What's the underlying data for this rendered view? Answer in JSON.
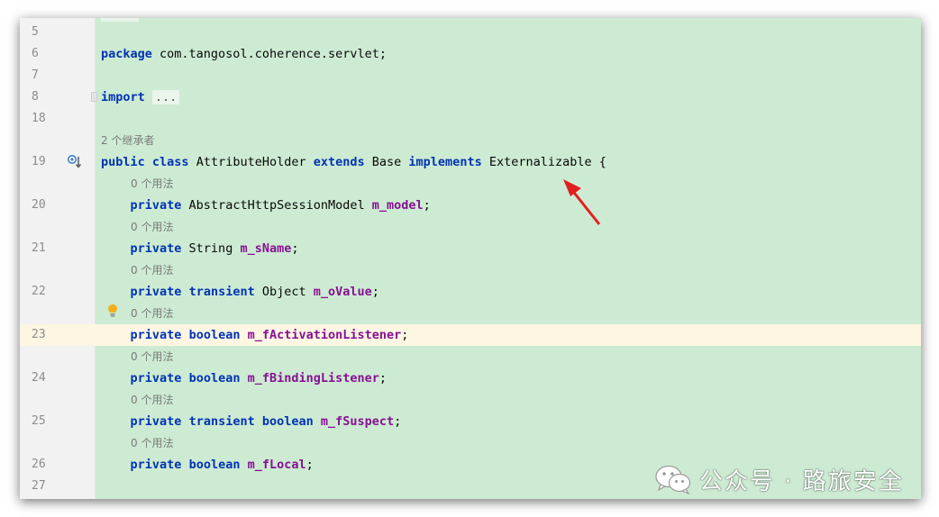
{
  "editor": {
    "lines": [
      {
        "kind": "code",
        "num": "5",
        "tokens": []
      },
      {
        "kind": "code",
        "num": "6",
        "tokens": [
          {
            "t": "package",
            "c": "kw"
          },
          {
            "t": " com.tangosol.coherence.servlet;",
            "c": ""
          }
        ]
      },
      {
        "kind": "code",
        "num": "7",
        "tokens": []
      },
      {
        "kind": "code",
        "num": "8",
        "tokens": [
          {
            "t": "import",
            "c": "kw"
          },
          {
            "t": " ",
            "c": ""
          },
          {
            "t": "...",
            "c": "folded"
          }
        ]
      },
      {
        "kind": "code",
        "num": "18",
        "tokens": []
      },
      {
        "kind": "hint",
        "indent": 0,
        "text": "2 个继承者"
      },
      {
        "kind": "code",
        "num": "19",
        "tokens": [
          {
            "t": "public",
            "c": "kw"
          },
          {
            "t": " ",
            "c": ""
          },
          {
            "t": "class",
            "c": "kw"
          },
          {
            "t": " AttributeHolder ",
            "c": ""
          },
          {
            "t": "extends",
            "c": "kw"
          },
          {
            "t": " Base ",
            "c": ""
          },
          {
            "t": "implements",
            "c": "kw"
          },
          {
            "t": " Externalizable {",
            "c": ""
          }
        ]
      },
      {
        "kind": "hint",
        "indent": 1,
        "text": "0 个用法"
      },
      {
        "kind": "code",
        "num": "20",
        "tokens": [
          {
            "t": "    ",
            "c": ""
          },
          {
            "t": "private",
            "c": "kw"
          },
          {
            "t": " AbstractHttpSessionModel ",
            "c": ""
          },
          {
            "t": "m_model",
            "c": "fld"
          },
          {
            "t": ";",
            "c": ""
          }
        ]
      },
      {
        "kind": "hint",
        "indent": 1,
        "text": "0 个用法"
      },
      {
        "kind": "code",
        "num": "21",
        "tokens": [
          {
            "t": "    ",
            "c": ""
          },
          {
            "t": "private",
            "c": "kw"
          },
          {
            "t": " String ",
            "c": ""
          },
          {
            "t": "m_sName",
            "c": "fld"
          },
          {
            "t": ";",
            "c": ""
          }
        ]
      },
      {
        "kind": "hint",
        "indent": 1,
        "text": "0 个用法"
      },
      {
        "kind": "code",
        "num": "22",
        "tokens": [
          {
            "t": "    ",
            "c": ""
          },
          {
            "t": "private",
            "c": "kw"
          },
          {
            "t": " ",
            "c": ""
          },
          {
            "t": "transient",
            "c": "kw"
          },
          {
            "t": " Object ",
            "c": ""
          },
          {
            "t": "m_oValue",
            "c": "fld"
          },
          {
            "t": ";",
            "c": ""
          }
        ]
      },
      {
        "kind": "hint",
        "indent": 1,
        "text": "0 个用法"
      },
      {
        "kind": "code",
        "num": "23",
        "highlight": true,
        "tokens": [
          {
            "t": "    ",
            "c": ""
          },
          {
            "t": "private",
            "c": "kw"
          },
          {
            "t": " ",
            "c": ""
          },
          {
            "t": "boolean",
            "c": "kw"
          },
          {
            "t": " ",
            "c": ""
          },
          {
            "t": "m_fActivationListener",
            "c": "fld"
          },
          {
            "t": ";",
            "c": ""
          }
        ]
      },
      {
        "kind": "hint",
        "indent": 1,
        "text": "0 个用法"
      },
      {
        "kind": "code",
        "num": "24",
        "tokens": [
          {
            "t": "    ",
            "c": ""
          },
          {
            "t": "private",
            "c": "kw"
          },
          {
            "t": " ",
            "c": ""
          },
          {
            "t": "boolean",
            "c": "kw"
          },
          {
            "t": " ",
            "c": ""
          },
          {
            "t": "m_fBindingListener",
            "c": "fld"
          },
          {
            "t": ";",
            "c": ""
          }
        ]
      },
      {
        "kind": "hint",
        "indent": 1,
        "text": "0 个用法"
      },
      {
        "kind": "code",
        "num": "25",
        "tokens": [
          {
            "t": "    ",
            "c": ""
          },
          {
            "t": "private",
            "c": "kw"
          },
          {
            "t": " ",
            "c": ""
          },
          {
            "t": "transient",
            "c": "kw"
          },
          {
            "t": " ",
            "c": ""
          },
          {
            "t": "boolean",
            "c": "kw"
          },
          {
            "t": " ",
            "c": ""
          },
          {
            "t": "m_fSuspect",
            "c": "fld"
          },
          {
            "t": ";",
            "c": ""
          }
        ]
      },
      {
        "kind": "hint",
        "indent": 1,
        "text": "0 个用法"
      },
      {
        "kind": "code",
        "num": "26",
        "tokens": [
          {
            "t": "    ",
            "c": ""
          },
          {
            "t": "private",
            "c": "kw"
          },
          {
            "t": " ",
            "c": ""
          },
          {
            "t": "boolean",
            "c": "kw"
          },
          {
            "t": " ",
            "c": ""
          },
          {
            "t": "m_fLocal",
            "c": "fld"
          },
          {
            "t": ";",
            "c": ""
          }
        ]
      },
      {
        "kind": "code",
        "num": "27",
        "tokens": []
      }
    ],
    "gutter_icons": {
      "line19": "implemented-by-icon",
      "line22_hint": "lightbulb-icon"
    }
  },
  "colors": {
    "editor_bg": "#cdebd2",
    "gutter_bg": "#f2f2f2",
    "current_line_bg": "#fdf6e3",
    "keyword": "#0033b3",
    "field": "#871094",
    "hint": "#7a7a7a",
    "annotation_arrow": "#e02020"
  },
  "watermark": {
    "text": "公众号 · 路旅安全",
    "icon": "wechat-icon"
  }
}
